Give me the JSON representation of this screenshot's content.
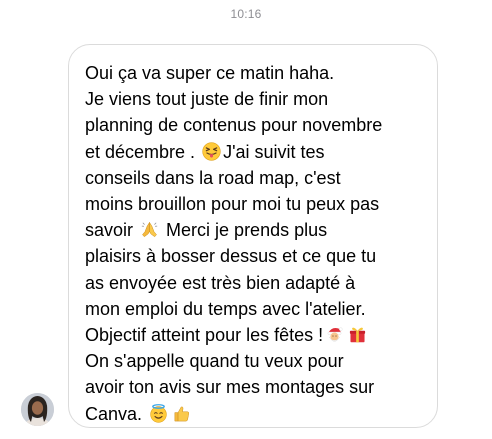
{
  "header": {
    "timestamp": "10:16"
  },
  "message": {
    "lines": [
      "Oui ça va super ce matin haha.",
      "Je viens tout juste de finir mon",
      "planning de contenus pour novembre",
      "et décembre .",
      "J'ai suivit tes",
      "conseils dans la road map, c'est",
      "moins brouillon pour moi tu peux pas",
      "savoir",
      "Merci je prends plus",
      "plaisirs à bosser dessus et ce que tu",
      "as envoyée est très bien adapté à",
      "mon emploi du temps avec l'atelier.",
      "Objectif atteint pour les fêtes !",
      "On s'appelle quand tu veux pour",
      "avoir ton avis sur mes montages sur",
      "Canva."
    ],
    "emojis": [
      "squinting-tongue-emoji",
      "folded-hands-emoji",
      "santa-emoji",
      "gift-emoji",
      "halo-smile-emoji",
      "thumbs-up-emoji"
    ]
  },
  "sender": {
    "avatar": "profile-photo"
  },
  "colors": {
    "bubble_border": "#dbdbdb",
    "timestamp": "#8e8e93",
    "text": "#000000"
  }
}
